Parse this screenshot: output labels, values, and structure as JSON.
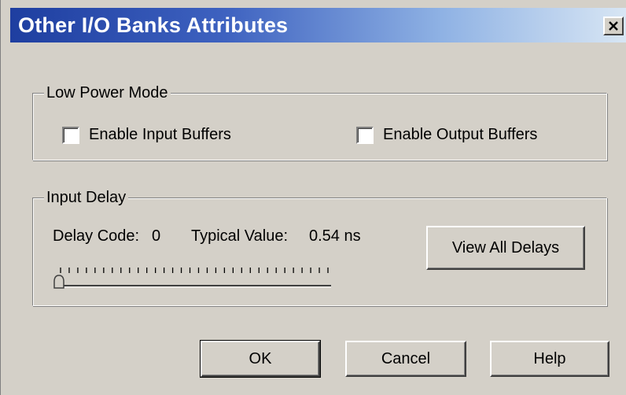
{
  "dialog": {
    "title": "Other I/O Banks Attributes",
    "close_icon": "close-icon"
  },
  "low_power": {
    "label": "Low Power Mode",
    "enable_input_label": "Enable Input Buffers",
    "enable_input_checked": false,
    "enable_output_label": "Enable Output Buffers",
    "enable_output_checked": false
  },
  "input_delay": {
    "label": "Input Delay",
    "delay_code_label": "Delay Code:",
    "delay_code_value": "0",
    "typical_label": "Typical Value:",
    "typical_value": "0.54 ns",
    "view_all_label": "View All Delays",
    "slider_position": 0
  },
  "buttons": {
    "ok_label": "OK",
    "cancel_label": "Cancel",
    "help_label": "Help"
  },
  "colors": {
    "titlebar_start": "#1e3ea0",
    "titlebar_end": "#d8e6f4",
    "face": "#d4d0c8"
  }
}
